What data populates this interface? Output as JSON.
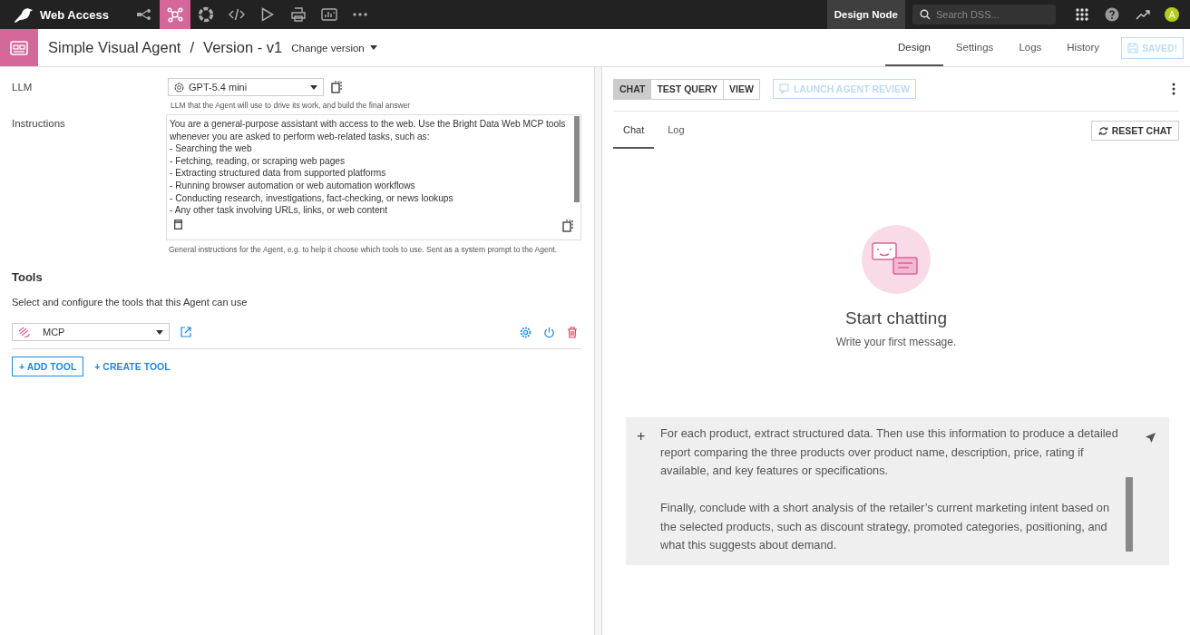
{
  "topbar": {
    "project": "Web Access",
    "nav": [
      {
        "kind": "flow",
        "selected": false
      },
      {
        "kind": "agent",
        "selected": true
      },
      {
        "kind": "ring",
        "selected": false
      },
      {
        "kind": "code",
        "selected": false
      },
      {
        "kind": "play",
        "selected": false
      },
      {
        "kind": "printer",
        "selected": false
      },
      {
        "kind": "dashboard",
        "selected": false
      },
      {
        "kind": "more",
        "selected": false
      }
    ],
    "node": "Design Node",
    "search": {
      "placeholder": "Search DSS..."
    },
    "avatar": "A"
  },
  "header": {
    "title": "Simple Visual Agent",
    "separator": "/",
    "version": "Version - v1",
    "change_version": "Change version",
    "tabs": [
      {
        "label": "Design",
        "selected": true
      },
      {
        "label": "Settings",
        "selected": false
      },
      {
        "label": "Logs",
        "selected": false
      },
      {
        "label": "History",
        "selected": false
      }
    ],
    "save_button": {
      "label": "SAVED!",
      "disabled": true
    }
  },
  "form": {
    "llm": {
      "label": "LLM",
      "value": "GPT-5.4 mini",
      "help": "LLM that the Agent will use to drive its work, and build the final answer"
    },
    "instructions": {
      "label": "Instructions",
      "value": "You are a general-purpose assistant with access to the web. Use the Bright Data Web MCP tools whenever you are asked to perform web-related tasks, such as:\n- Searching the web\n- Fetching, reading, or scraping web pages\n- Extracting structured data from supported platforms\n- Running browser automation or web automation workflows\n- Conducting research, investigations, fact-checking, or news lookups\n- Any other task involving URLs, links, or web content",
      "help": "General instructions for the Agent, e.g. to help it choose which tools to use. Sent as a system prompt to the Agent."
    },
    "tools": {
      "title": "Tools",
      "description": "Select and configure the tools that this Agent can use",
      "items": [
        {
          "name": "MCP"
        }
      ],
      "add": "+ ADD TOOL",
      "create": "+ CREATE TOOL"
    }
  },
  "chat_panel": {
    "modes": [
      {
        "label": "CHAT",
        "selected": true
      },
      {
        "label": "TEST QUERY",
        "selected": false
      },
      {
        "label": "VIEW",
        "selected": false
      }
    ],
    "review_button": {
      "label": "LAUNCH AGENT REVIEW",
      "disabled": true
    },
    "tabs": [
      {
        "label": "Chat",
        "selected": true
      },
      {
        "label": "Log",
        "selected": false
      }
    ],
    "reset": "RESET CHAT",
    "empty": {
      "title": "Start chatting",
      "subtitle": "Write your first message."
    },
    "composer": {
      "plus": "+",
      "value": "For each product, extract structured data. Then use this information to produce a detailed report comparing the three products over product name, description, price, rating if available, and key features or specifications.\n\nFinally, conclude with a short analysis of the retailer’s current marketing intent based on the selected products, such as discount strategy, promoted categories, positioning, and what this suggests about demand."
    }
  }
}
